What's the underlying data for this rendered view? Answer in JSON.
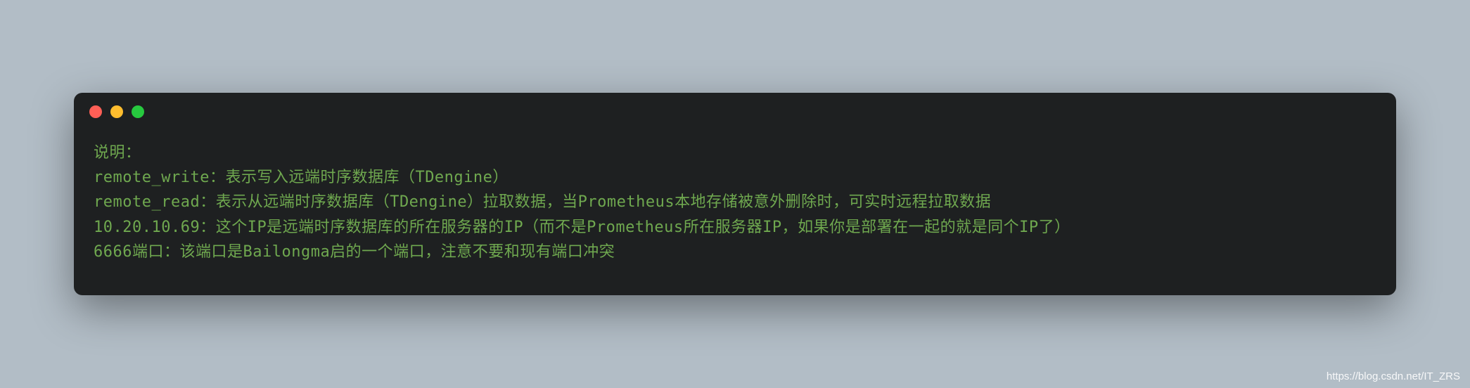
{
  "terminal": {
    "lines": [
      "说明：",
      "remote_write：表示写入远端时序数据库（TDengine）",
      "remote_read：表示从远端时序数据库（TDengine）拉取数据，当Prometheus本地存储被意外删除时，可实时远程拉取数据",
      "10.20.10.69：这个IP是远端时序数据库的所在服务器的IP（而不是Prometheus所在服务器IP，如果你是部署在一起的就是同个IP了）",
      "6666端口：该端口是Bailongma启的一个端口，注意不要和现有端口冲突"
    ]
  },
  "watermark": "https://blog.csdn.net/IT_ZRS"
}
